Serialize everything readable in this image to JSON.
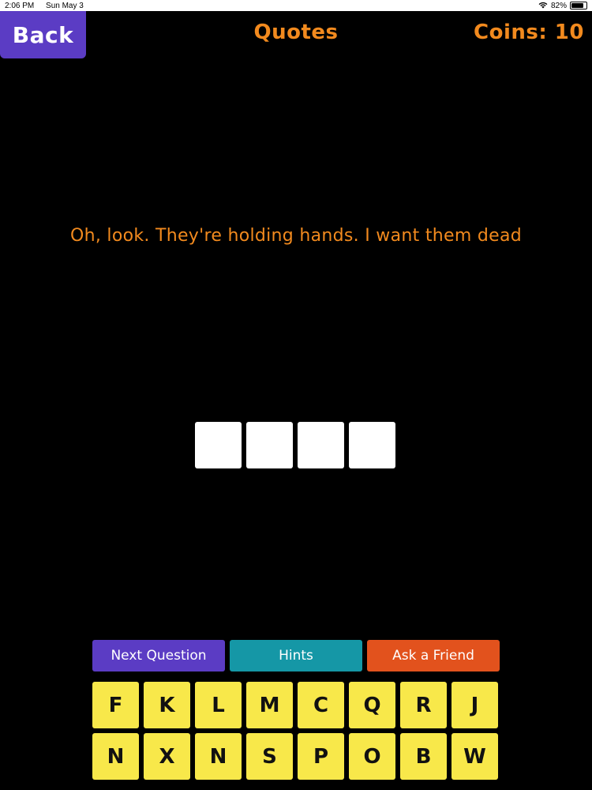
{
  "status": {
    "time": "2:06 PM",
    "date": "Sun May 3",
    "battery": "82%",
    "battery_level": 0.82,
    "wifi_icon": "wifi-icon",
    "battery_icon": "battery-icon"
  },
  "header": {
    "back_label": "Back",
    "title": "Quotes",
    "coins": "Coins: 10"
  },
  "quote": "Oh, look. They're holding hands. I want them dead",
  "answer": {
    "slots": [
      "",
      "",
      "",
      ""
    ]
  },
  "actions": {
    "next_label": "Next Question",
    "hints_label": "Hints",
    "friend_label": "Ask a Friend"
  },
  "keyboard": {
    "keys": [
      "F",
      "K",
      "L",
      "M",
      "C",
      "Q",
      "R",
      "J",
      "N",
      "X",
      "N",
      "S",
      "P",
      "O",
      "B",
      "W"
    ]
  },
  "colors": {
    "background": "#000000",
    "accent_orange": "#f28a1e",
    "purple": "#5b3cc4",
    "teal": "#1597a6",
    "red_orange": "#e2521d",
    "key_yellow": "#f8e84a"
  }
}
